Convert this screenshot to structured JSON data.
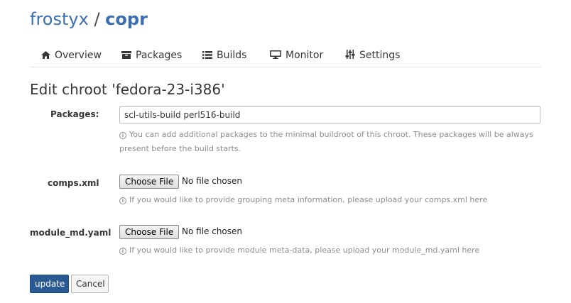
{
  "header": {
    "owner": "frostyx",
    "separator": "/",
    "project": "copr"
  },
  "tabs": [
    {
      "label": "Overview",
      "icon": "home-icon"
    },
    {
      "label": "Packages",
      "icon": "archive-icon"
    },
    {
      "label": "Builds",
      "icon": "list-icon"
    },
    {
      "label": "Monitor",
      "icon": "desktop-icon"
    },
    {
      "label": "Settings",
      "icon": "sliders-icon"
    }
  ],
  "page_title": "Edit chroot 'fedora-23-i386'",
  "form": {
    "packages": {
      "label": "Packages:",
      "value": "scl-utils-build perl516-build",
      "help_line1": "You can add additional packages to the minimal buildroot of this chroot. These packages will be always",
      "help_line2": "present before the build starts."
    },
    "comps": {
      "label": "comps.xml",
      "button": "Choose File",
      "status": "No file chosen",
      "help": "If you would like to provide grouping meta information, please upload your comps.xml here"
    },
    "module_md": {
      "label": "module_md.yaml",
      "button": "Choose File",
      "status": "No file chosen",
      "help": "If you would like to provide module meta-data, please upload your module_md.yaml here"
    },
    "info_icon_glyph": "i"
  },
  "actions": {
    "update": "update",
    "cancel": "Cancel"
  },
  "colors": {
    "link_blue": "#3c6eb4",
    "primary_button": "#2a5a94"
  }
}
